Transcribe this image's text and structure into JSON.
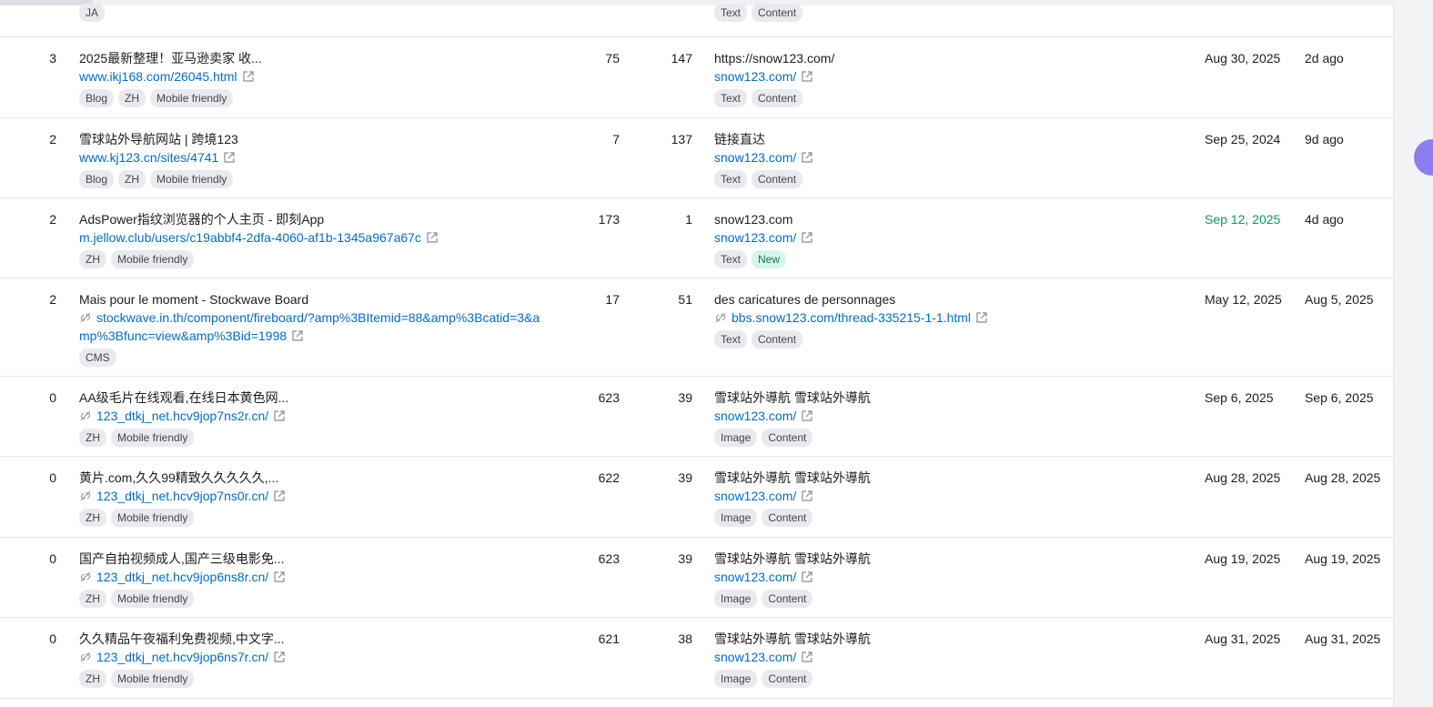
{
  "top_row": {
    "tags": [
      "JA"
    ],
    "anchor_tags": [
      "Text",
      "Content"
    ]
  },
  "rows": [
    {
      "rank": "3",
      "title": "2025最新整理！亚马逊卖家 收...",
      "url": "www.ikj168.com/26045.html",
      "tags": [
        "Blog",
        "ZH",
        "Mobile friendly"
      ],
      "n1": "75",
      "n2": "147",
      "anchor": "https://snow123.com/",
      "target": "snow123.com/",
      "anchor_tags": [
        "Text",
        "Content"
      ],
      "first_seen": "Aug 30, 2025",
      "last_seen": "2d ago"
    },
    {
      "rank": "2",
      "title": "雪球站外导航网站 | 跨境123",
      "url": "www.kj123.cn/sites/4741",
      "tags": [
        "Blog",
        "ZH",
        "Mobile friendly"
      ],
      "n1": "7",
      "n2": "137",
      "anchor": "链接直达",
      "target": "snow123.com/",
      "anchor_tags": [
        "Text",
        "Content"
      ],
      "first_seen": "Sep 25, 2024",
      "last_seen": "9d ago"
    },
    {
      "rank": "2",
      "title": "AdsPower指纹浏览器的个人主页 - 即刻App",
      "url": "m.jellow.club/users/c19abbf4-2dfa-4060-af1b-1345a967a67c",
      "tags": [
        "ZH",
        "Mobile friendly"
      ],
      "n1": "173",
      "n2": "1",
      "anchor": "snow123.com",
      "target": "snow123.com/",
      "anchor_tags": [
        "Text",
        "New"
      ],
      "first_seen": "Sep 12, 2025",
      "last_seen": "4d ago"
    },
    {
      "rank": "2",
      "title": "Mais pour le moment - Stockwave Board",
      "url": "stockwave.in.th/component/fireboard/?amp%3BItemid=88&amp%3Bcatid=3&amp%3Bfunc=view&amp%3Bid=1998",
      "tags": [
        "CMS"
      ],
      "n1": "17",
      "n2": "51",
      "anchor": "des caricatures de personnages",
      "target": "bbs.snow123.com/thread-335215-1-1.html",
      "anchor_tags": [
        "Text",
        "Content"
      ],
      "first_seen": "May 12, 2025",
      "last_seen": "Aug 5, 2025"
    },
    {
      "rank": "0",
      "title": "AA级毛片在线观看,在线日本黄色网...",
      "url": "123_dtkj_net.hcv9jop7ns2r.cn/",
      "tags": [
        "ZH",
        "Mobile friendly"
      ],
      "n1": "623",
      "n2": "39",
      "anchor": "雪球站外導航 雪球站外導航",
      "target": "snow123.com/",
      "anchor_tags": [
        "Image",
        "Content"
      ],
      "first_seen": "Sep 6, 2025",
      "last_seen": "Sep 6, 2025"
    },
    {
      "rank": "0",
      "title": "黄片.com,久久99精致久久久久久,...",
      "url": "123_dtkj_net.hcv9jop7ns0r.cn/",
      "tags": [
        "ZH",
        "Mobile friendly"
      ],
      "n1": "622",
      "n2": "39",
      "anchor": "雪球站外導航 雪球站外導航",
      "target": "snow123.com/",
      "anchor_tags": [
        "Image",
        "Content"
      ],
      "first_seen": "Aug 28, 2025",
      "last_seen": "Aug 28, 2025"
    },
    {
      "rank": "0",
      "title": "国产自拍视频成人,国产三级电影免...",
      "url": "123_dtkj_net.hcv9jop6ns8r.cn/",
      "tags": [
        "ZH",
        "Mobile friendly"
      ],
      "n1": "623",
      "n2": "39",
      "anchor": "雪球站外導航 雪球站外導航",
      "target": "snow123.com/",
      "anchor_tags": [
        "Image",
        "Content"
      ],
      "first_seen": "Aug 19, 2025",
      "last_seen": "Aug 19, 2025"
    },
    {
      "rank": "0",
      "title": "久久精品午夜福利免费视频,中文字...",
      "url": "123_dtkj_net.hcv9jop6ns7r.cn/",
      "tags": [
        "ZH",
        "Mobile friendly"
      ],
      "n1": "621",
      "n2": "38",
      "anchor": "雪球站外導航 雪球站外導航",
      "target": "snow123.com/",
      "anchor_tags": [
        "Image",
        "Content"
      ],
      "first_seen": "Aug 31, 2025",
      "last_seen": "Aug 31, 2025"
    }
  ],
  "colors": {
    "link": "#006dca",
    "new_date": "#0a9a63",
    "tag_bg": "#e9eaee",
    "new_tag_bg": "#d9f5ea"
  },
  "icons": {
    "external": "external-link-icon",
    "broken": "broken-link-icon"
  }
}
